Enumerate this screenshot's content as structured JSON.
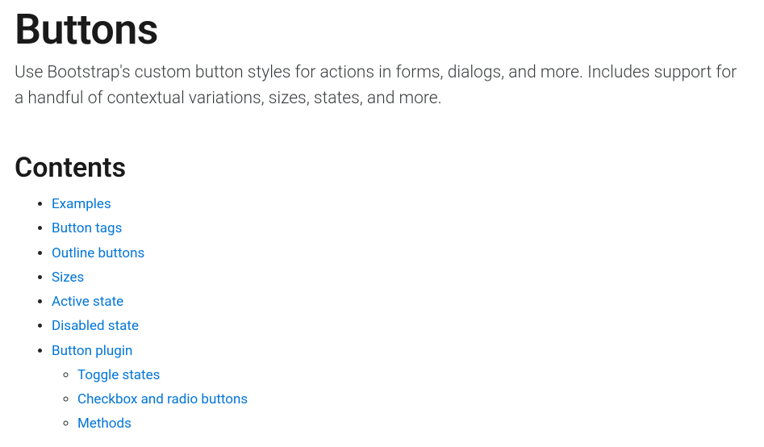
{
  "page": {
    "title": "Buttons",
    "lead": "Use Bootstrap's custom button styles for actions in forms, dialogs, and more. Includes support for a handful of contextual variations, sizes, states, and more."
  },
  "contents": {
    "heading": "Contents",
    "items": [
      {
        "label": "Examples"
      },
      {
        "label": "Button tags"
      },
      {
        "label": "Outline buttons"
      },
      {
        "label": "Sizes"
      },
      {
        "label": "Active state"
      },
      {
        "label": "Disabled state"
      },
      {
        "label": "Button plugin",
        "children": [
          {
            "label": "Toggle states"
          },
          {
            "label": "Checkbox and radio buttons"
          },
          {
            "label": "Methods"
          }
        ]
      }
    ]
  }
}
